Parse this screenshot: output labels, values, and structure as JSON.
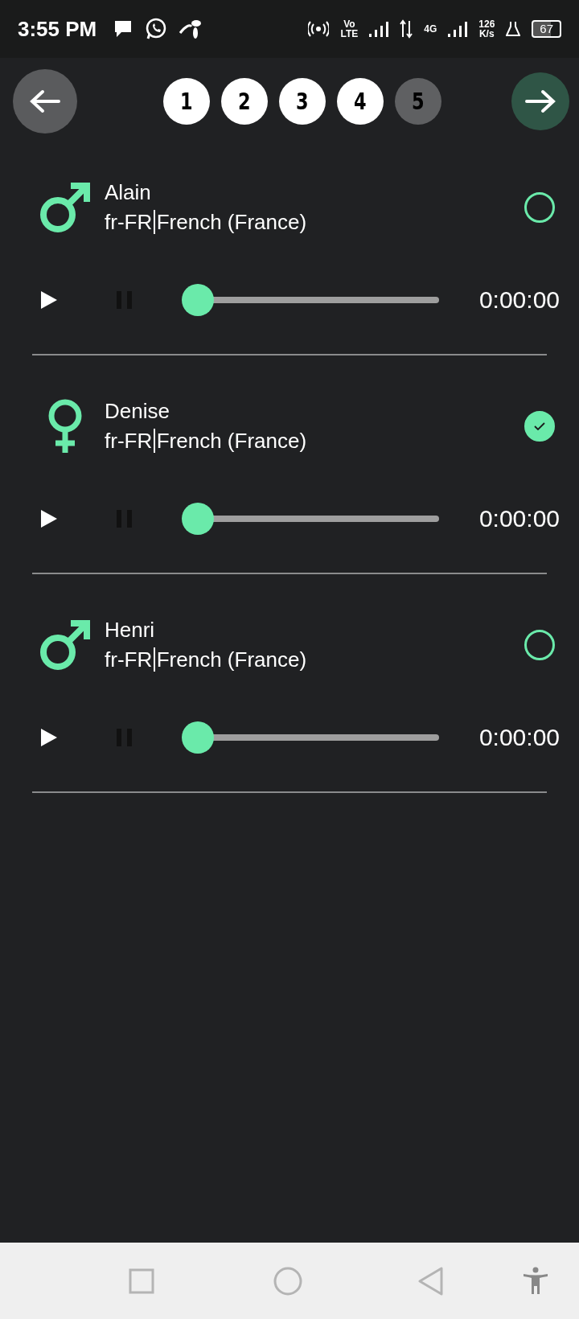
{
  "status_bar": {
    "time": "3:55 PM",
    "volte": [
      "Vo",
      "LTE"
    ],
    "network": "4G",
    "speed": [
      "126",
      "K/s"
    ],
    "battery": "67"
  },
  "steps": [
    {
      "label": "1",
      "done": true
    },
    {
      "label": "2",
      "done": true
    },
    {
      "label": "3",
      "done": true
    },
    {
      "label": "4",
      "done": true
    },
    {
      "label": "5",
      "done": false
    }
  ],
  "voices": [
    {
      "name": "Alain",
      "code": "fr-FR",
      "language": "French (France)",
      "kind": "male",
      "selected": false,
      "level": 0,
      "time": "0:00:00"
    },
    {
      "name": "Denise",
      "code": "fr-FR",
      "language": "French (France)",
      "kind": "female",
      "selected": true,
      "level": 0,
      "time": "0:00:00"
    },
    {
      "name": "Henri",
      "code": "fr-FR",
      "language": "French (France)",
      "kind": "male",
      "selected": false,
      "level": 0,
      "time": "0:00:00"
    }
  ]
}
